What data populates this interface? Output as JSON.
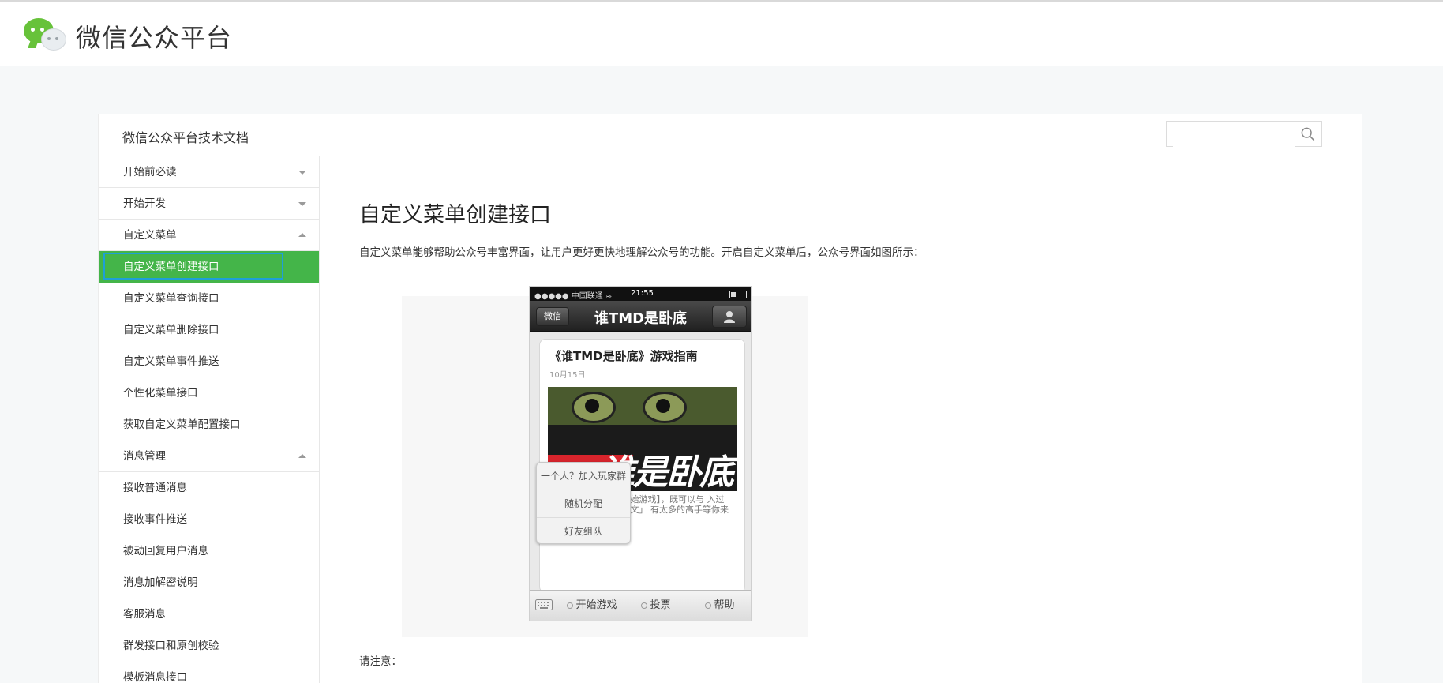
{
  "header": {
    "brand_title": "微信公众平台"
  },
  "panel": {
    "docs_title": "微信公众平台技术文档",
    "search": {
      "placeholder": "",
      "value": ""
    }
  },
  "sidebar": {
    "items": [
      {
        "label": "开始前必读",
        "type": "group",
        "state": "collapsed"
      },
      {
        "label": "开始开发",
        "type": "group",
        "state": "collapsed"
      },
      {
        "label": "自定义菜单",
        "type": "group",
        "state": "expanded"
      },
      {
        "label": "自定义菜单创建接口",
        "type": "item",
        "active": true
      },
      {
        "label": "自定义菜单查询接口",
        "type": "item"
      },
      {
        "label": "自定义菜单删除接口",
        "type": "item"
      },
      {
        "label": "自定义菜单事件推送",
        "type": "item"
      },
      {
        "label": "个性化菜单接口",
        "type": "item"
      },
      {
        "label": "获取自定义菜单配置接口",
        "type": "item"
      },
      {
        "label": "消息管理",
        "type": "group",
        "state": "expanded"
      },
      {
        "label": "接收普通消息",
        "type": "item"
      },
      {
        "label": "接收事件推送",
        "type": "item"
      },
      {
        "label": "被动回复用户消息",
        "type": "item"
      },
      {
        "label": "消息加解密说明",
        "type": "item"
      },
      {
        "label": "客服消息",
        "type": "item"
      },
      {
        "label": "群发接口和原创校验",
        "type": "item"
      },
      {
        "label": "模板消息接口",
        "type": "item"
      }
    ]
  },
  "content": {
    "title": "自定义菜单创建接口",
    "intro": "自定义菜单能够帮助公众号丰富界面，让用户更好更快地理解公众号的功能。开启自定义菜单后，公众号界面如图所示：",
    "note": "请注意："
  },
  "figure": {
    "status": {
      "carrier": "●●●●● 中国联通 ≈",
      "time": "21:55"
    },
    "back_label": "微信",
    "chat_title": "谁TMD是卧底",
    "article_title": "《谁TMD是卧底》游戏指南",
    "article_date": "10月15日",
    "image_text": "谁是卧底",
    "article_text": "广游戏，三平民一卧 始游戏】，既可以与 入过招。 议点击「阅读全文」 有太多的高手等你来 战哦。",
    "popup_items": [
      "一个人？加入玩家群",
      "随机分配",
      "好友组队"
    ],
    "menu_tabs": [
      "开始游戏",
      "投票",
      "帮助"
    ]
  },
  "colors": {
    "accent_green": "#44b549",
    "focus_blue": "#1e9fd8",
    "page_bg": "#f6f8f9"
  }
}
